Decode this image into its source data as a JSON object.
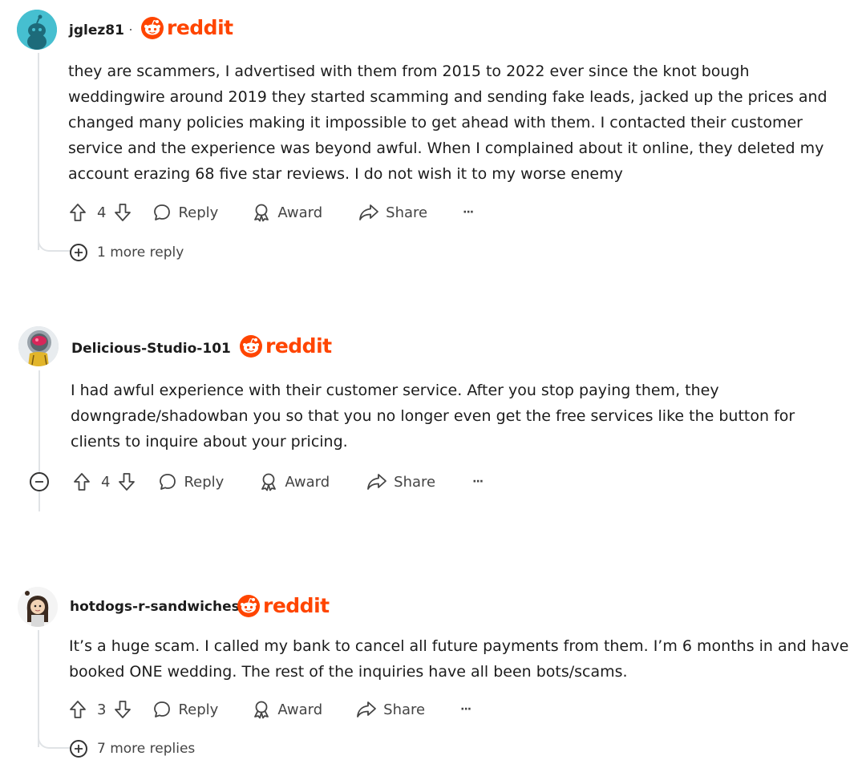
{
  "comments": [
    {
      "username": "jglez81",
      "brand": "reddit",
      "lines": [
        "they are scammers, I advertised with them from 2015 to 2022 ever since the knot bough",
        "weddingwire around 2019 they started scamming and sending fake leads, jacked up the prices and",
        "changed many policies making it impossible to get ahead with them. I contacted their customer",
        "service and the experience was beyond awful. When I complained about it online, they deleted my",
        "account erazing 68 five star reviews. I do not wish it to my worse enemy"
      ],
      "votes": "4",
      "more_replies": "1 more reply"
    },
    {
      "username": "Delicious-Studio-101",
      "brand": "reddit",
      "lines": [
        "I had awful experience with their customer service. After you stop paying them, they",
        "downgrade/shadowban you so that you no longer even get the free services like the button for",
        "clients to inquire about your pricing."
      ],
      "votes": "4"
    },
    {
      "username": "hotdogs-r-sandwiches",
      "brand": "reddit",
      "lines": [
        "It’s a huge scam. I called my bank to cancel all future payments from them. I’m 6 months in and have",
        "booked ONE wedding. The rest of the inquiries have all been bots/scams."
      ],
      "votes": "3",
      "more_replies": "7 more replies"
    }
  ],
  "actions": {
    "reply": "Reply",
    "award": "Award",
    "share": "Share",
    "overflow": "···"
  },
  "separator": "·",
  "colors": {
    "brand": "#ff4500",
    "text": "#1c1c1c",
    "muted": "#444444",
    "thread_line": "#e0e3e6"
  },
  "icons": [
    "upvote-icon",
    "downvote-icon",
    "reply-icon",
    "award-icon",
    "share-icon",
    "expand-icon",
    "collapse-icon",
    "snoo-icon"
  ]
}
